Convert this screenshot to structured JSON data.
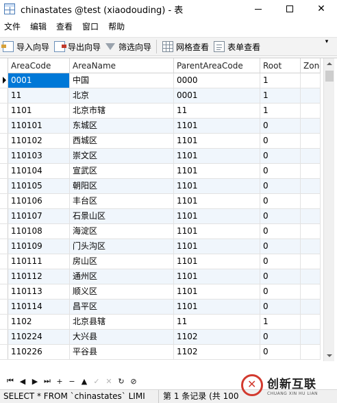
{
  "window": {
    "title": "chinastates @test (xiaodouding) - 表",
    "minimize": "—",
    "close": "✕"
  },
  "menu": [
    "文件",
    "编辑",
    "查看",
    "窗口",
    "帮助"
  ],
  "toolbar": {
    "import_wizard": "导入向导",
    "export_wizard": "导出向导",
    "filter_wizard": "筛选向导",
    "grid_view": "网格查看",
    "form_view": "表单查看",
    "overflow": "▾"
  },
  "grid": {
    "columns": [
      "AreaCode",
      "AreaName",
      "ParentAreaCode",
      "Root",
      "Zone"
    ],
    "rows": [
      {
        "code": "0001",
        "name": "中国",
        "parent": "0000",
        "root": "1"
      },
      {
        "code": "11",
        "name": "北京",
        "parent": "0001",
        "root": "1"
      },
      {
        "code": "1101",
        "name": "北京市辖",
        "parent": "11",
        "root": "1"
      },
      {
        "code": "110101",
        "name": "东城区",
        "parent": "1101",
        "root": "0"
      },
      {
        "code": "110102",
        "name": "西城区",
        "parent": "1101",
        "root": "0"
      },
      {
        "code": "110103",
        "name": "崇文区",
        "parent": "1101",
        "root": "0"
      },
      {
        "code": "110104",
        "name": "宣武区",
        "parent": "1101",
        "root": "0"
      },
      {
        "code": "110105",
        "name": "朝阳区",
        "parent": "1101",
        "root": "0"
      },
      {
        "code": "110106",
        "name": "丰台区",
        "parent": "1101",
        "root": "0"
      },
      {
        "code": "110107",
        "name": "石景山区",
        "parent": "1101",
        "root": "0"
      },
      {
        "code": "110108",
        "name": "海淀区",
        "parent": "1101",
        "root": "0"
      },
      {
        "code": "110109",
        "name": "门头沟区",
        "parent": "1101",
        "root": "0"
      },
      {
        "code": "110111",
        "name": "房山区",
        "parent": "1101",
        "root": "0"
      },
      {
        "code": "110112",
        "name": "通州区",
        "parent": "1101",
        "root": "0"
      },
      {
        "code": "110113",
        "name": "顺义区",
        "parent": "1101",
        "root": "0"
      },
      {
        "code": "110114",
        "name": "昌平区",
        "parent": "1101",
        "root": "0"
      },
      {
        "code": "1102",
        "name": "北京县辖",
        "parent": "11",
        "root": "1"
      },
      {
        "code": "110224",
        "name": "大兴县",
        "parent": "1102",
        "root": "0"
      },
      {
        "code": "110226",
        "name": "平谷县",
        "parent": "1102",
        "root": "0"
      }
    ]
  },
  "navigation": [
    "⏮",
    "◀",
    "▶",
    "⏭",
    "+",
    "−",
    "▲",
    "✓",
    "✕",
    "↻",
    "⊘"
  ],
  "status": {
    "sql": "SELECT * FROM `chinastates` LIMI",
    "record": "第 1 条记录 (共 100"
  },
  "watermark": {
    "cn": "创新互联",
    "en": "CHUANG XIN HU LIAN"
  },
  "colors": {
    "selection": "#0078d7",
    "alt_row": "#f0f6fc",
    "toolbar": "#f3f3f3"
  }
}
